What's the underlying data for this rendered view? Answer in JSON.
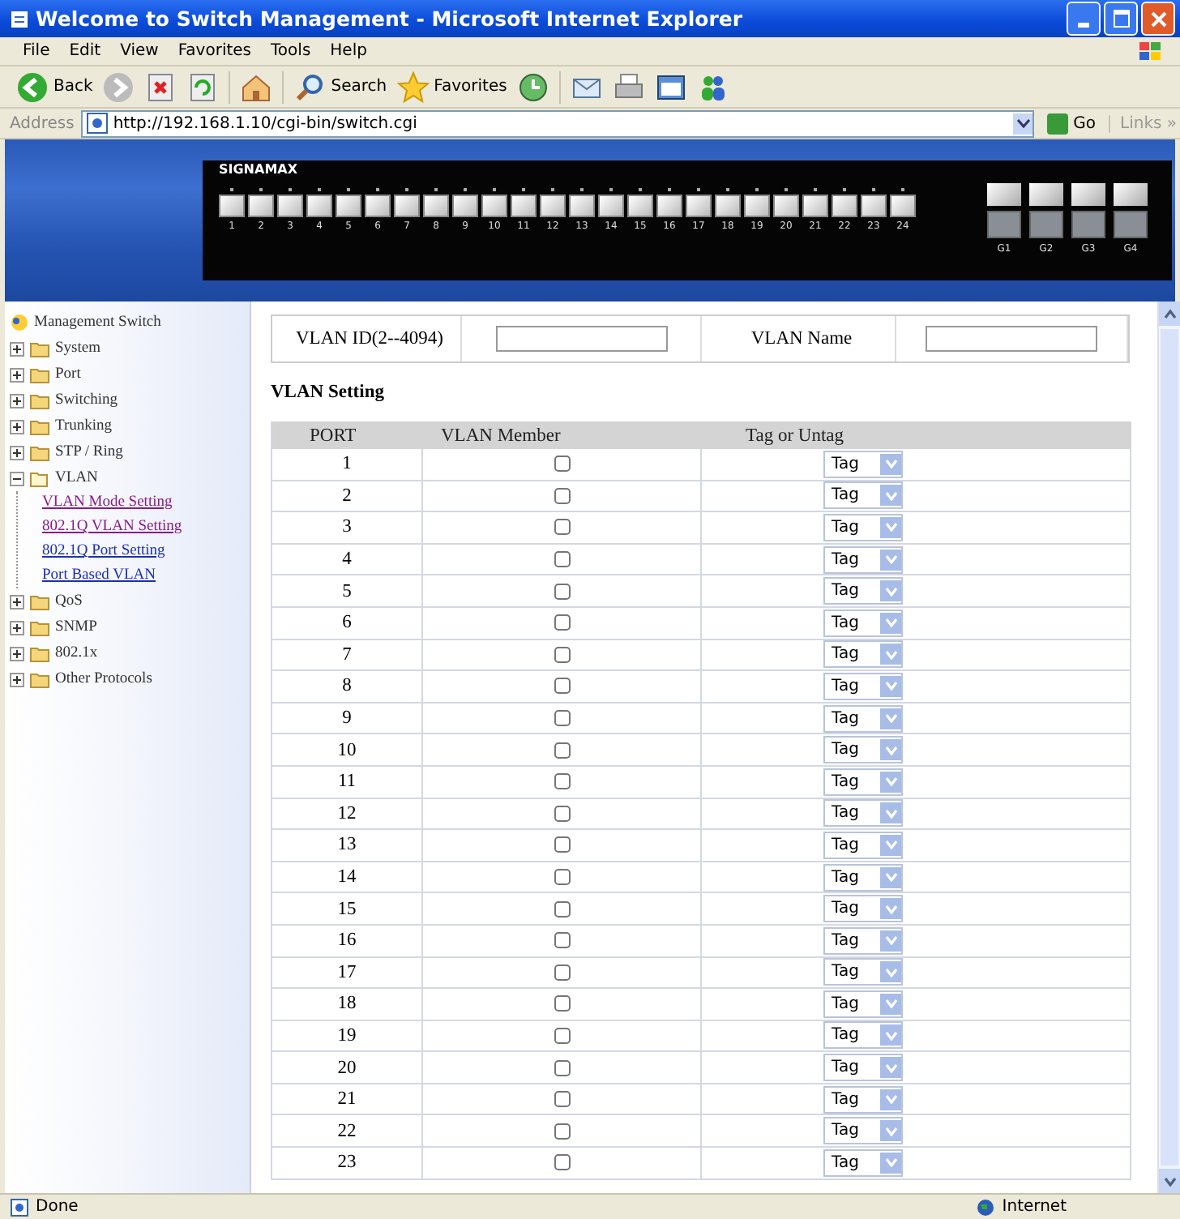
{
  "window": {
    "title": "Welcome to Switch Management - Microsoft Internet Explorer"
  },
  "menu": [
    "File",
    "Edit",
    "View",
    "Favorites",
    "Tools",
    "Help"
  ],
  "toolbar": [
    {
      "kind": "back",
      "label": "Back"
    },
    {
      "kind": "forward"
    },
    {
      "kind": "stop"
    },
    {
      "kind": "refresh"
    },
    {
      "kind": "home"
    },
    {
      "kind": "search",
      "label": "Search"
    },
    {
      "kind": "favorites",
      "label": "Favorites"
    },
    {
      "kind": "history"
    },
    {
      "kind": "mail"
    },
    {
      "kind": "print"
    },
    {
      "kind": "edit"
    },
    {
      "kind": "messenger"
    }
  ],
  "address_bar": {
    "label": "Address",
    "url": "http://192.168.1.10/cgi-bin/switch.cgi",
    "go": "Go",
    "links": "Links »"
  },
  "banner": {
    "logo": "SIGNAMAX",
    "ports": [
      "1",
      "2",
      "3",
      "4",
      "5",
      "6",
      "7",
      "8",
      "9",
      "10",
      "11",
      "12",
      "13",
      "14",
      "15",
      "16",
      "17",
      "18",
      "19",
      "20",
      "21",
      "22",
      "23",
      "24"
    ],
    "uplinks": [
      "G1",
      "G2",
      "G3",
      "G4"
    ]
  },
  "sidebar": {
    "root": "Management Switch",
    "items": [
      {
        "label": "System",
        "expanded": false
      },
      {
        "label": "Port",
        "expanded": false
      },
      {
        "label": "Switching",
        "expanded": false
      },
      {
        "label": "Trunking",
        "expanded": false
      },
      {
        "label": "STP / Ring",
        "expanded": false
      },
      {
        "label": "VLAN",
        "expanded": true,
        "children": [
          {
            "label": "VLAN Mode Setting",
            "visited": true
          },
          {
            "label": "802.1Q VLAN Setting",
            "visited": true
          },
          {
            "label": "802.1Q Port Setting",
            "visited": false
          },
          {
            "label": "Port Based VLAN",
            "visited": false
          }
        ]
      },
      {
        "label": "QoS",
        "expanded": false
      },
      {
        "label": "SNMP",
        "expanded": false
      },
      {
        "label": "802.1x",
        "expanded": false
      },
      {
        "label": "Other Protocols",
        "expanded": false
      }
    ]
  },
  "vlan_form": {
    "id_label": "VLAN ID(2--4094)",
    "name_label": "VLAN Name"
  },
  "section_title": "VLAN Setting",
  "table": {
    "columns": [
      "PORT",
      "VLAN Member",
      "Tag or Untag"
    ],
    "rows": [
      {
        "port": "1",
        "member": false,
        "tag": "Tag"
      },
      {
        "port": "2",
        "member": false,
        "tag": "Tag"
      },
      {
        "port": "3",
        "member": false,
        "tag": "Tag"
      },
      {
        "port": "4",
        "member": false,
        "tag": "Tag"
      },
      {
        "port": "5",
        "member": false,
        "tag": "Tag"
      },
      {
        "port": "6",
        "member": false,
        "tag": "Tag"
      },
      {
        "port": "7",
        "member": false,
        "tag": "Tag"
      },
      {
        "port": "8",
        "member": false,
        "tag": "Tag"
      },
      {
        "port": "9",
        "member": false,
        "tag": "Tag"
      },
      {
        "port": "10",
        "member": false,
        "tag": "Tag"
      },
      {
        "port": "11",
        "member": false,
        "tag": "Tag"
      },
      {
        "port": "12",
        "member": false,
        "tag": "Tag"
      },
      {
        "port": "13",
        "member": false,
        "tag": "Tag"
      },
      {
        "port": "14",
        "member": false,
        "tag": "Tag"
      },
      {
        "port": "15",
        "member": false,
        "tag": "Tag"
      },
      {
        "port": "16",
        "member": false,
        "tag": "Tag"
      },
      {
        "port": "17",
        "member": false,
        "tag": "Tag"
      },
      {
        "port": "18",
        "member": false,
        "tag": "Tag"
      },
      {
        "port": "19",
        "member": false,
        "tag": "Tag"
      },
      {
        "port": "20",
        "member": false,
        "tag": "Tag"
      },
      {
        "port": "21",
        "member": false,
        "tag": "Tag"
      },
      {
        "port": "22",
        "member": false,
        "tag": "Tag"
      },
      {
        "port": "23",
        "member": false,
        "tag": "Tag"
      }
    ]
  },
  "status_bar": {
    "text": "Done",
    "zone": "Internet"
  }
}
